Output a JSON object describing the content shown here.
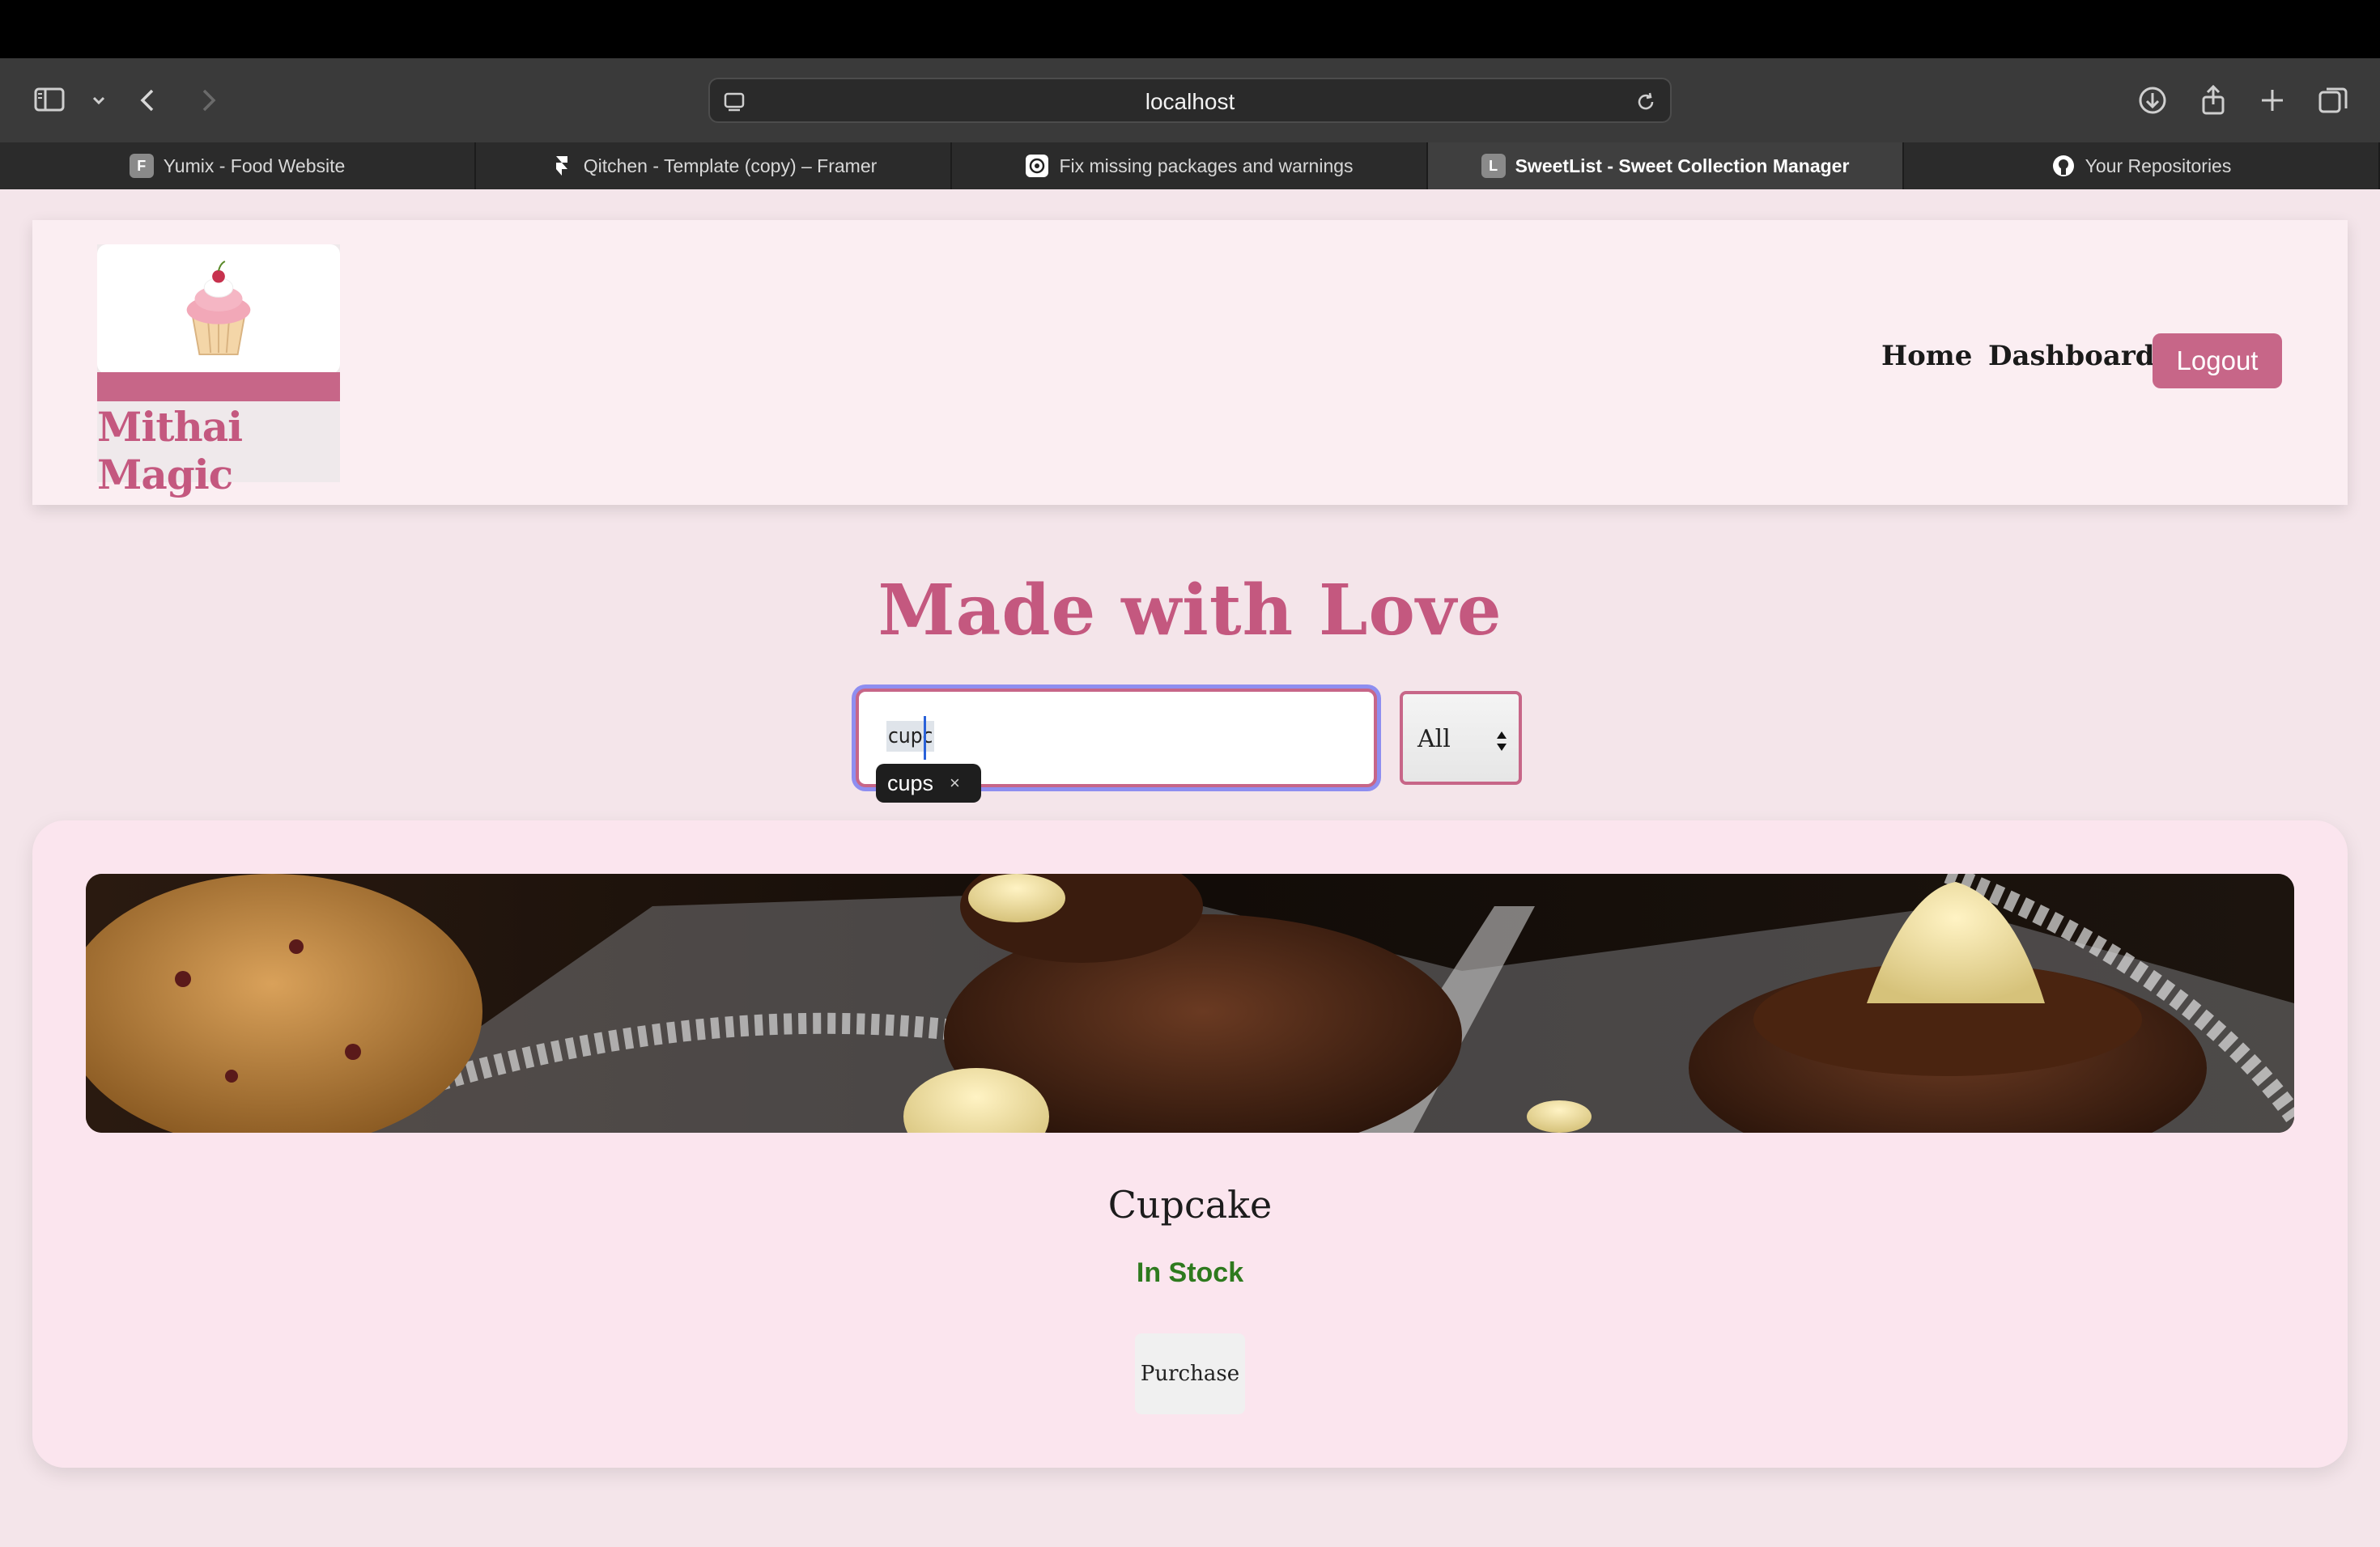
{
  "browser": {
    "url": "localhost",
    "tabs": [
      {
        "label": "Yumix - Food Website",
        "favicon": "F",
        "active": false
      },
      {
        "label": "Qitchen - Template (copy) – Framer",
        "favicon": "framer-icon",
        "active": false
      },
      {
        "label": "Fix missing packages and warnings",
        "favicon": "chatgpt-icon",
        "active": false
      },
      {
        "label": "SweetList - Sweet Collection Manager",
        "favicon": "L",
        "active": true
      },
      {
        "label": "Your Repositories",
        "favicon": "github-icon",
        "active": false
      }
    ]
  },
  "header": {
    "brand": "Mithai Magic",
    "nav": {
      "home": "Home",
      "dashboard": "Dashboard",
      "logout": "Logout"
    }
  },
  "hero": {
    "title": "Made with Love"
  },
  "search": {
    "value": "cupc",
    "suggestion": "cups",
    "suggestion_close": "×"
  },
  "filter": {
    "selected": "All"
  },
  "products": [
    {
      "name": "Cupcake",
      "status": "In Stock",
      "action": "Purchase"
    }
  ],
  "colors": {
    "accent": "#c76688",
    "background": "#f4e5ea",
    "in_stock": "#2e7a1e"
  }
}
